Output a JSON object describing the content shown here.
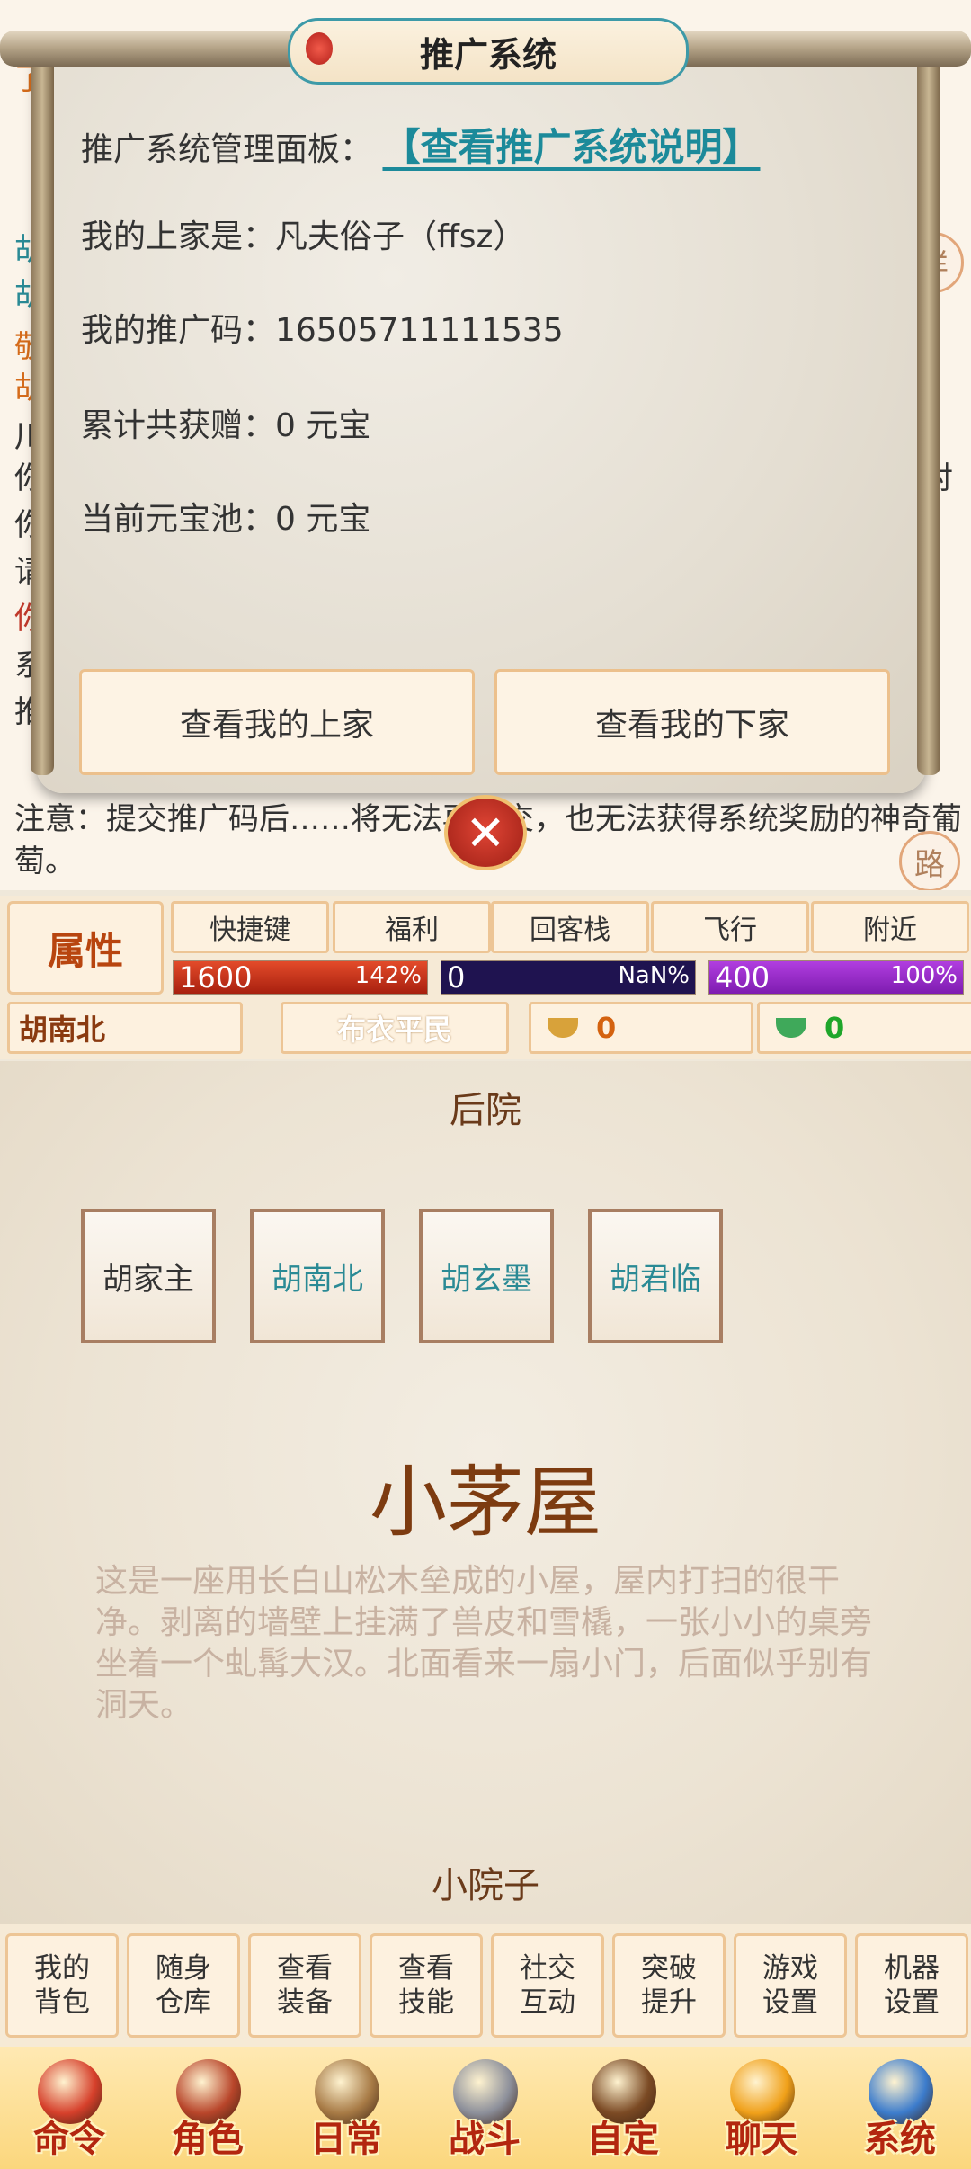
{
  "dialog": {
    "title": "推广系统",
    "panel_label": "推广系统管理面板：",
    "panel_link": "【查看推广系统说明】",
    "upline": "我的上家是：凡夫俗子（ffsz）",
    "promo_code": "我的推广码：16505711111535",
    "total_gift": "累计共获赠：0 元宝",
    "pool": "当前元宝池：0 元宝",
    "btn_upline": "查看我的上家",
    "btn_downline": "查看我的下家",
    "close_glyph": "✕"
  },
  "log": {
    "top_left_fragment": "了",
    "left_fragments": [
      "胡",
      "胡",
      "敬",
      "胡",
      "川",
      "你",
      "你",
      "请",
      "你",
      "系",
      "推"
    ],
    "right_fragment": "对",
    "notice": "注意：提交推广码后……将无法再提交，也无法获得系统奖励的神奇葡萄。",
    "round_buttons": [
      "详",
      "路"
    ]
  },
  "status": {
    "attr_label": "属性",
    "tabs": [
      "快捷键",
      "福利",
      "回客栈",
      "飞行",
      "附近"
    ],
    "hp": {
      "value": "1600",
      "pct": "142%",
      "fill": 1.0
    },
    "mp": {
      "value": "0",
      "pct": "NaN%",
      "fill": 0.0
    },
    "exp": {
      "value": "400",
      "pct": "100%",
      "fill": 1.0
    },
    "name": "胡南北",
    "rank": "布衣平民",
    "gold": "0",
    "silver": "0"
  },
  "scene": {
    "exit_north": "后院",
    "npcs": [
      "胡家主",
      "胡南北",
      "胡玄墨",
      "胡君临"
    ],
    "room_name": "小茅屋",
    "room_desc": "这是一座用长白山松木垒成的小屋，屋内打扫的很干净。剥离的墙壁上挂满了兽皮和雪橇，一张小小的桌旁坐着一个虬髯大汉。北面看来一扇小门，后面似乎别有洞天。",
    "exit_south": "小院子"
  },
  "commands": [
    [
      "我的",
      "背包"
    ],
    [
      "随身",
      "仓库"
    ],
    [
      "查看",
      "装备"
    ],
    [
      "查看",
      "技能"
    ],
    [
      "社交",
      "互动"
    ],
    [
      "突破",
      "提升"
    ],
    [
      "游戏",
      "设置"
    ],
    [
      "机器",
      "设置"
    ]
  ],
  "nav": [
    {
      "label": "命令",
      "icon": "shield-icon",
      "color": "#d6402b"
    },
    {
      "label": "角色",
      "icon": "warrior-icon",
      "color": "#b8452a"
    },
    {
      "label": "日常",
      "icon": "scroll-icon",
      "color": "#a77a45"
    },
    {
      "label": "战斗",
      "icon": "sword-icon",
      "color": "#8c8f9a"
    },
    {
      "label": "自定",
      "icon": "chest-icon",
      "color": "#7b4a24"
    },
    {
      "label": "聊天",
      "icon": "chat-icon",
      "color": "#f0a019"
    },
    {
      "label": "系统",
      "icon": "gear-icon",
      "color": "#3c7ccc"
    }
  ]
}
